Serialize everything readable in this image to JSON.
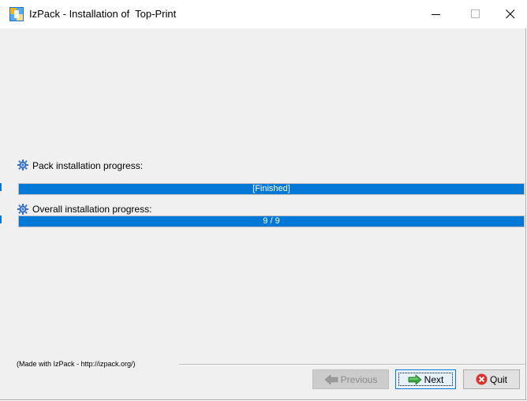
{
  "window": {
    "title": "IzPack - Installation of  Top-Print"
  },
  "install": {
    "pack_label": "Pack installation progress:",
    "pack_status": "[Finished]",
    "pack_progress": 1.0,
    "overall_label": "Overall installation progress:",
    "overall_status": "9 / 9",
    "overall_progress": 1.0
  },
  "footer": {
    "made_with": "(Made with IzPack - http://izpack.org/)"
  },
  "buttons": {
    "previous": "Previous",
    "next": "Next",
    "quit": "Quit"
  },
  "colors": {
    "accent": "#0078d7",
    "quit_icon": "#d9342b",
    "arrow_icon": "#3aa63a"
  },
  "icons": {
    "app": "izpack-app-icon",
    "section": "gear-icon",
    "previous": "arrow-left-icon",
    "next": "arrow-right-icon",
    "quit": "close-circle-icon"
  }
}
